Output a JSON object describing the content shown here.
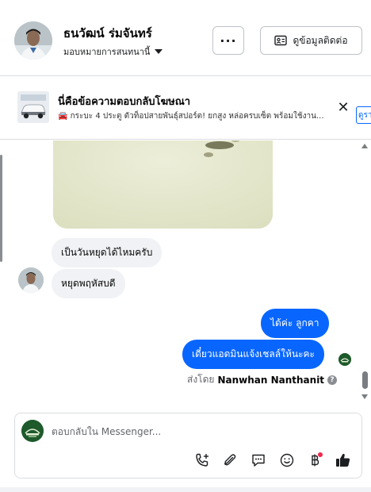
{
  "header": {
    "contact_name": "ธนวัฒน์ ร่มจันทร์",
    "assign_label": "มอบหมายการสนทนานี้",
    "more_label": "···",
    "contact_info_label": "ดูข้อมูลติดต่อ"
  },
  "ad": {
    "title": "นี่คือข้อความตอบกลับโฆษณา",
    "description": "🚘 กระบะ 4 ประตู ตัวท็อปสายพันธุ์สปอร์ต! ยกสูง หล่อครบเซ็ต พร้อมใช้งาน...",
    "view_label": "ดูรา"
  },
  "messages": [
    {
      "sender": "contact",
      "text": "เป็นวันหยุดได้ไหมครับ"
    },
    {
      "sender": "contact",
      "text": "หยุดพฤหัสบดี"
    },
    {
      "sender": "page",
      "text": "ได้ค่ะ  ลูกคา"
    },
    {
      "sender": "page",
      "text": "เดี๋ยวแอดมินแจ้งเชลล์ให้นะคะ"
    }
  ],
  "sent_by": {
    "prefix": "ส่งโดย",
    "name": "Nanwhan Nanthanit",
    "help": "?"
  },
  "composer": {
    "placeholder": "ตอบกลับใน Messenger...",
    "icons": [
      "phone-add-icon",
      "paperclip-icon",
      "quick-reply-icon",
      "emoji-icon",
      "baht-payment-icon",
      "thumbs-up-icon"
    ]
  },
  "colors": {
    "accent": "#0866ff",
    "incoming_bubble": "#f0f2f5",
    "notification_dot": "#f0284a"
  }
}
